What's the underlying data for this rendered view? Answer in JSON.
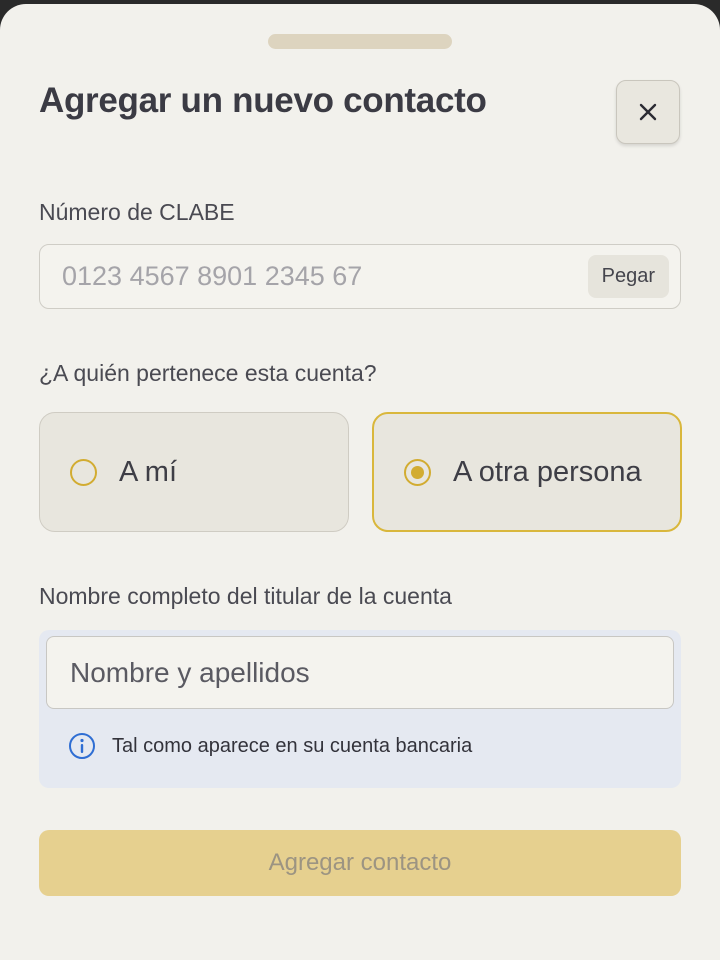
{
  "modal": {
    "title": "Agregar un nuevo contacto",
    "close_icon": "close-icon"
  },
  "clabe": {
    "label": "Número de CLABE",
    "value": "",
    "placeholder": "0123 4567 8901 2345 67",
    "paste_label": "Pegar"
  },
  "owner": {
    "question": "¿A quién pertenece esta cuenta?",
    "options": [
      {
        "label": "A mí",
        "selected": false
      },
      {
        "label": "A otra persona",
        "selected": true
      }
    ],
    "accent_color": "#d2ac31"
  },
  "holder": {
    "label": "Nombre completo del titular de la cuenta",
    "value": "",
    "placeholder": "Nombre y apellidos",
    "hint": "Tal como aparece en su cuenta bancaria",
    "hint_icon": "info-icon"
  },
  "submit": {
    "label": "Agregar contacto",
    "enabled": false,
    "color": "#e6d08f"
  }
}
